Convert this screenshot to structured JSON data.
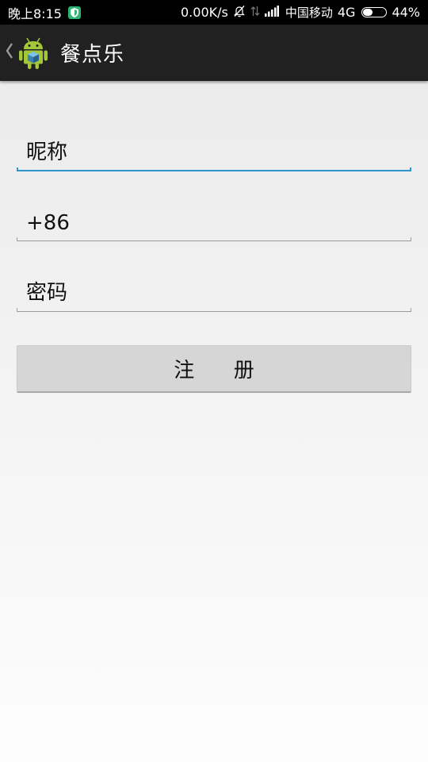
{
  "status_bar": {
    "time": "晚上8:15",
    "network_speed": "0.00K/s",
    "carrier": "中国移动",
    "network_type": "4G",
    "battery_percent_text": "44%",
    "battery_level": 0.44,
    "icons": [
      "shield-icon",
      "mute-bell-icon",
      "data-arrows-icon",
      "signal-icon",
      "battery-icon"
    ]
  },
  "action_bar": {
    "back_icon": "chevron-left-icon",
    "app_icon": "android-icon",
    "title": "餐点乐"
  },
  "form": {
    "nickname": {
      "placeholder": "昵称",
      "value": ""
    },
    "phone": {
      "value": "+86"
    },
    "password": {
      "placeholder": "密码",
      "value": ""
    },
    "register_label": "注      册"
  },
  "colors": {
    "status_bar_bg": "#000000",
    "action_bar_bg": "#212121",
    "focus_accent": "#2d95c9",
    "shield_badge": "#2bb673",
    "android_green": "#a4c639",
    "button_bg": "#d6d6d6"
  }
}
